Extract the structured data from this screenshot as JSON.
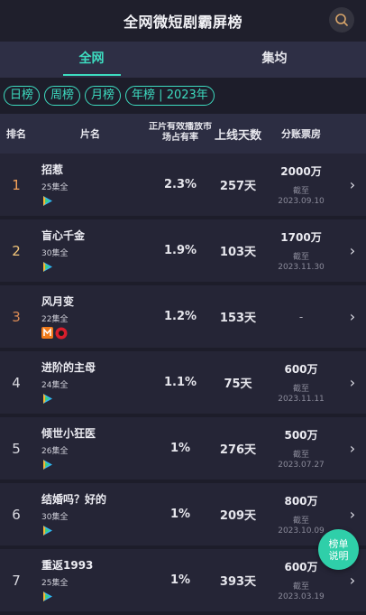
{
  "header": {
    "title": "全网微短剧霸屏榜",
    "search_icon": "search-icon"
  },
  "tabs": [
    {
      "label": "全网",
      "active": true
    },
    {
      "label": "集均",
      "active": false
    }
  ],
  "filters": [
    "日榜",
    "周榜",
    "月榜",
    "年榜 | 2023年"
  ],
  "columns": {
    "rank": "排名",
    "name": "片名",
    "share": "正片有效播放市场占有率",
    "days": "上线天数",
    "box_office": "分账票房"
  },
  "rows": [
    {
      "rank": "1",
      "title": "招惹",
      "episodes": "25集全",
      "platforms": [
        "platform-play-icon"
      ],
      "share": "2.3%",
      "days": "257天",
      "box_value": "2000万",
      "box_label": "截至",
      "box_date": "2023.09.10"
    },
    {
      "rank": "2",
      "title": "盲心千金",
      "episodes": "30集全",
      "platforms": [
        "platform-play-icon"
      ],
      "share": "1.9%",
      "days": "103天",
      "box_value": "1700万",
      "box_label": "截至",
      "box_date": "2023.11.30"
    },
    {
      "rank": "3",
      "title": "风月变",
      "episodes": "22集全",
      "platforms": [
        "platform-orange-icon",
        "platform-red-icon"
      ],
      "share": "1.2%",
      "days": "153天",
      "box_value": "-",
      "box_label": "",
      "box_date": ""
    },
    {
      "rank": "4",
      "title": "进阶的主母",
      "episodes": "24集全",
      "platforms": [
        "platform-play-icon"
      ],
      "share": "1.1%",
      "days": "75天",
      "box_value": "600万",
      "box_label": "截至",
      "box_date": "2023.11.11"
    },
    {
      "rank": "5",
      "title": "倾世小狂医",
      "episodes": "26集全",
      "platforms": [
        "platform-play-icon"
      ],
      "share": "1%",
      "days": "276天",
      "box_value": "500万",
      "box_label": "截至",
      "box_date": "2023.07.27"
    },
    {
      "rank": "6",
      "title": "结婚吗？好的",
      "episodes": "30集全",
      "platforms": [
        "platform-play-icon"
      ],
      "share": "1%",
      "days": "209天",
      "box_value": "800万",
      "box_label": "截至",
      "box_date": "2023.10.09"
    },
    {
      "rank": "7",
      "title": "重返1993",
      "episodes": "25集全",
      "platforms": [
        "platform-play-icon"
      ],
      "share": "1%",
      "days": "393天",
      "box_value": "600万",
      "box_label": "截至",
      "box_date": "2023.03.19"
    }
  ],
  "float_button": {
    "line1": "榜单",
    "line2": "说明"
  },
  "colors": {
    "accent": "#3ddcc0",
    "rank1": "#f5a25a",
    "rank2": "#f3c67a",
    "rank3": "#d98a55"
  }
}
